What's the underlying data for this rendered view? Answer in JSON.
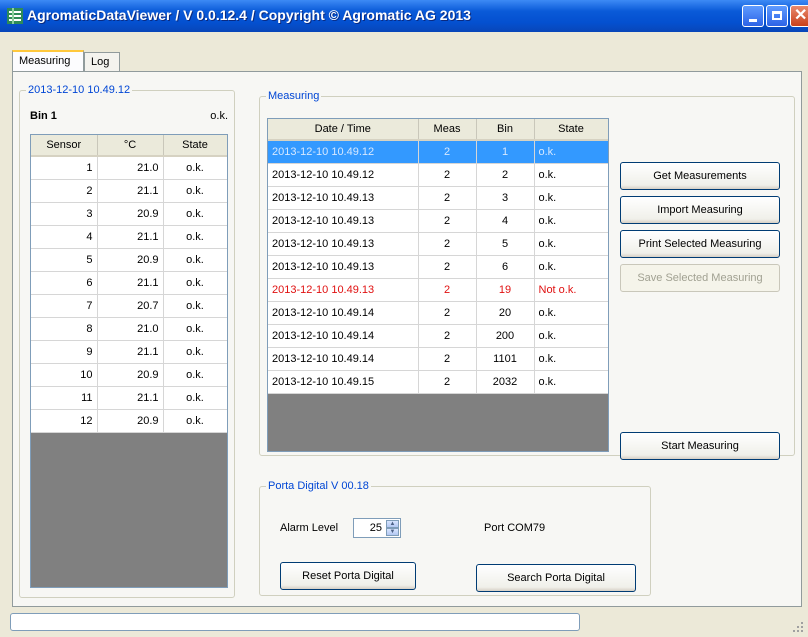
{
  "window": {
    "title": "AgromaticDataViewer / V 0.0.12.4 / Copyright © Agromatic AG 2013",
    "controls": {
      "minimize": "minimize-icon",
      "maximize": "maximize-icon",
      "close": "close-icon"
    }
  },
  "tabs": [
    {
      "label": "Measuring",
      "active": true
    },
    {
      "label": "Log",
      "active": false
    }
  ],
  "bin_group": {
    "legend": "2013-12-10 10.49.12",
    "bin_label": "Bin 1",
    "bin_state": "o.k.",
    "columns": [
      "Sensor",
      "°C",
      "State"
    ],
    "rows": [
      {
        "sensor": "1",
        "temp": "21.0",
        "state": "o.k."
      },
      {
        "sensor": "2",
        "temp": "21.1",
        "state": "o.k."
      },
      {
        "sensor": "3",
        "temp": "20.9",
        "state": "o.k."
      },
      {
        "sensor": "4",
        "temp": "21.1",
        "state": "o.k."
      },
      {
        "sensor": "5",
        "temp": "20.9",
        "state": "o.k."
      },
      {
        "sensor": "6",
        "temp": "21.1",
        "state": "o.k."
      },
      {
        "sensor": "7",
        "temp": "20.7",
        "state": "o.k."
      },
      {
        "sensor": "8",
        "temp": "21.0",
        "state": "o.k."
      },
      {
        "sensor": "9",
        "temp": "21.1",
        "state": "o.k."
      },
      {
        "sensor": "10",
        "temp": "20.9",
        "state": "o.k."
      },
      {
        "sensor": "11",
        "temp": "21.1",
        "state": "o.k."
      },
      {
        "sensor": "12",
        "temp": "20.9",
        "state": "o.k."
      }
    ]
  },
  "measuring_group": {
    "legend": "Measuring",
    "columns": [
      "Date / Time",
      "Meas",
      "Bin",
      "State"
    ],
    "rows": [
      {
        "datetime": "2013-12-10 10.49.12",
        "meas": "2",
        "bin": "1",
        "state": "o.k.",
        "selected": true,
        "error": false
      },
      {
        "datetime": "2013-12-10 10.49.12",
        "meas": "2",
        "bin": "2",
        "state": "o.k.",
        "selected": false,
        "error": false
      },
      {
        "datetime": "2013-12-10 10.49.13",
        "meas": "2",
        "bin": "3",
        "state": "o.k.",
        "selected": false,
        "error": false
      },
      {
        "datetime": "2013-12-10 10.49.13",
        "meas": "2",
        "bin": "4",
        "state": "o.k.",
        "selected": false,
        "error": false
      },
      {
        "datetime": "2013-12-10 10.49.13",
        "meas": "2",
        "bin": "5",
        "state": "o.k.",
        "selected": false,
        "error": false
      },
      {
        "datetime": "2013-12-10 10.49.13",
        "meas": "2",
        "bin": "6",
        "state": "o.k.",
        "selected": false,
        "error": false
      },
      {
        "datetime": "2013-12-10 10.49.13",
        "meas": "2",
        "bin": "19",
        "state": "Not o.k.",
        "selected": false,
        "error": true
      },
      {
        "datetime": "2013-12-10 10.49.14",
        "meas": "2",
        "bin": "20",
        "state": "o.k.",
        "selected": false,
        "error": false
      },
      {
        "datetime": "2013-12-10 10.49.14",
        "meas": "2",
        "bin": "200",
        "state": "o.k.",
        "selected": false,
        "error": false
      },
      {
        "datetime": "2013-12-10 10.49.14",
        "meas": "2",
        "bin": "1101",
        "state": "o.k.",
        "selected": false,
        "error": false
      },
      {
        "datetime": "2013-12-10 10.49.15",
        "meas": "2",
        "bin": "2032",
        "state": "o.k.",
        "selected": false,
        "error": false
      }
    ]
  },
  "buttons": {
    "get_measurements": "Get Measurements",
    "import_measuring": "Import Measuring",
    "print_selected": "Print Selected Measuring",
    "save_selected": "Save Selected Measuring",
    "start_measuring": "Start Measuring"
  },
  "porta_group": {
    "legend": "Porta Digital V 00.18",
    "alarm_label": "Alarm Level",
    "alarm_value": "25",
    "port_label": "Port COM79",
    "reset_button": "Reset Porta Digital",
    "search_button": "Search Porta Digital"
  },
  "colors": {
    "title_bar": "#0450d0",
    "selection": "#3399ff",
    "error_text": "#e01010",
    "legend_text": "#0046d5"
  }
}
